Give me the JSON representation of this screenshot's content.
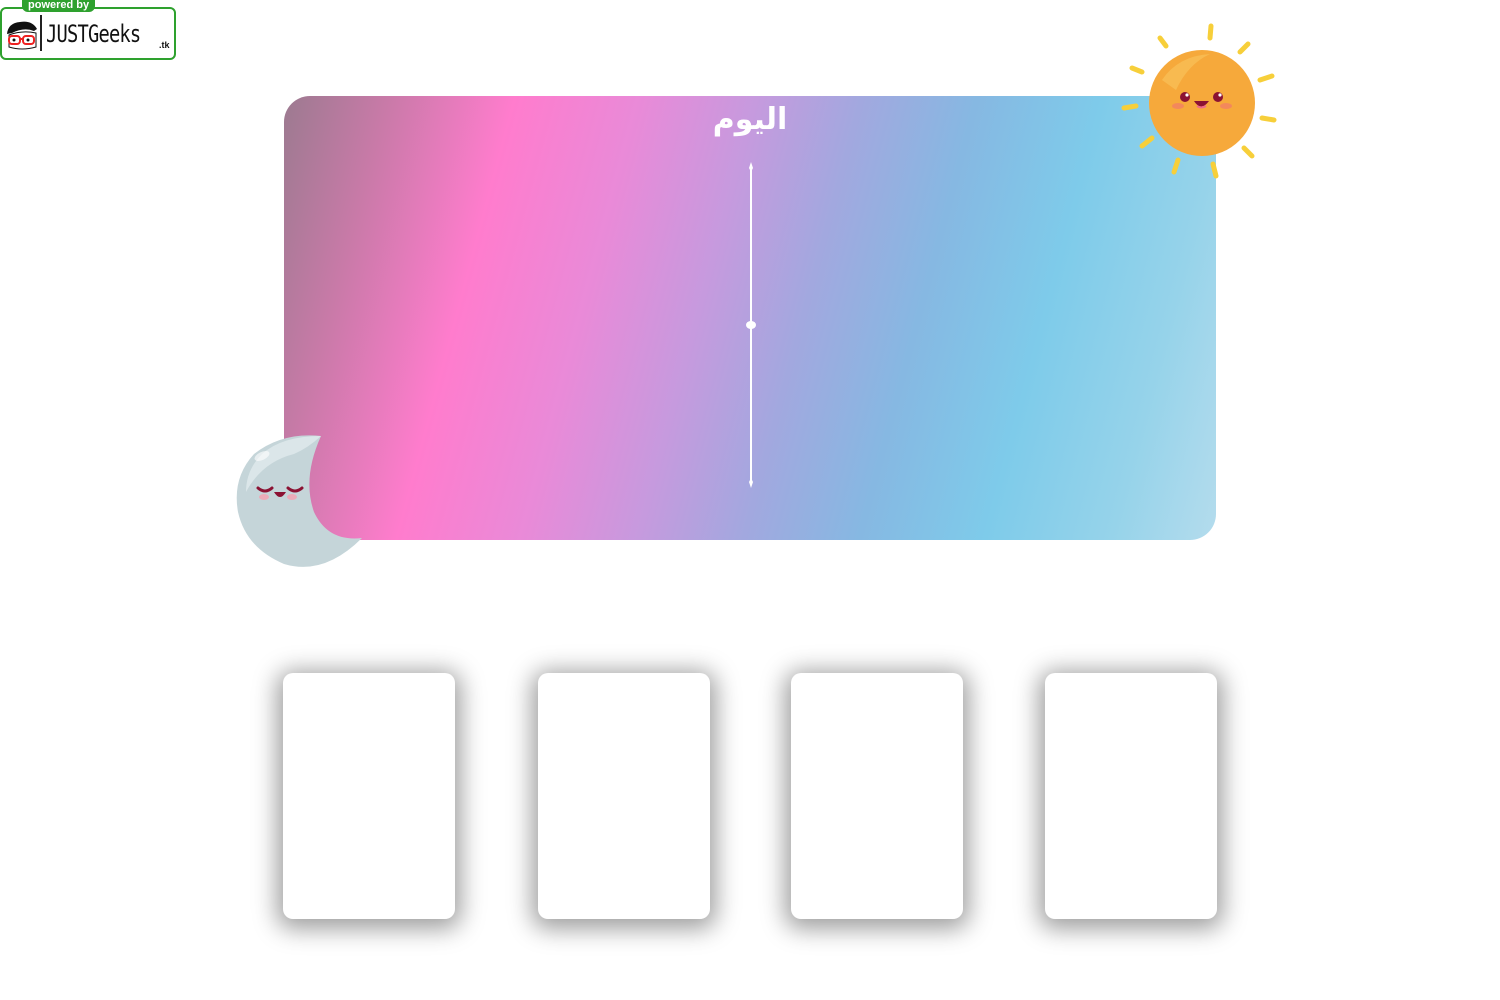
{
  "badge": {
    "powered_label": "powered by",
    "brand_label": "JUSTGeeks",
    "tld_label": ".tk",
    "accent_color": "#2ea12e",
    "icon": "geek-face-icon"
  },
  "panel": {
    "title": "اليوم",
    "gradient_colors": [
      "#9c7a90",
      "#ff7ccd",
      "#c69ade",
      "#7ecbea",
      "#b4dced"
    ],
    "divider_icon": "vertical-divider-icon"
  },
  "decorations": {
    "sun_icon": "smiling-sun-icon",
    "moon_icon": "sleeping-moon-icon"
  },
  "cards": [
    {
      "id": "card-1"
    },
    {
      "id": "card-2"
    },
    {
      "id": "card-3"
    },
    {
      "id": "card-4"
    }
  ]
}
